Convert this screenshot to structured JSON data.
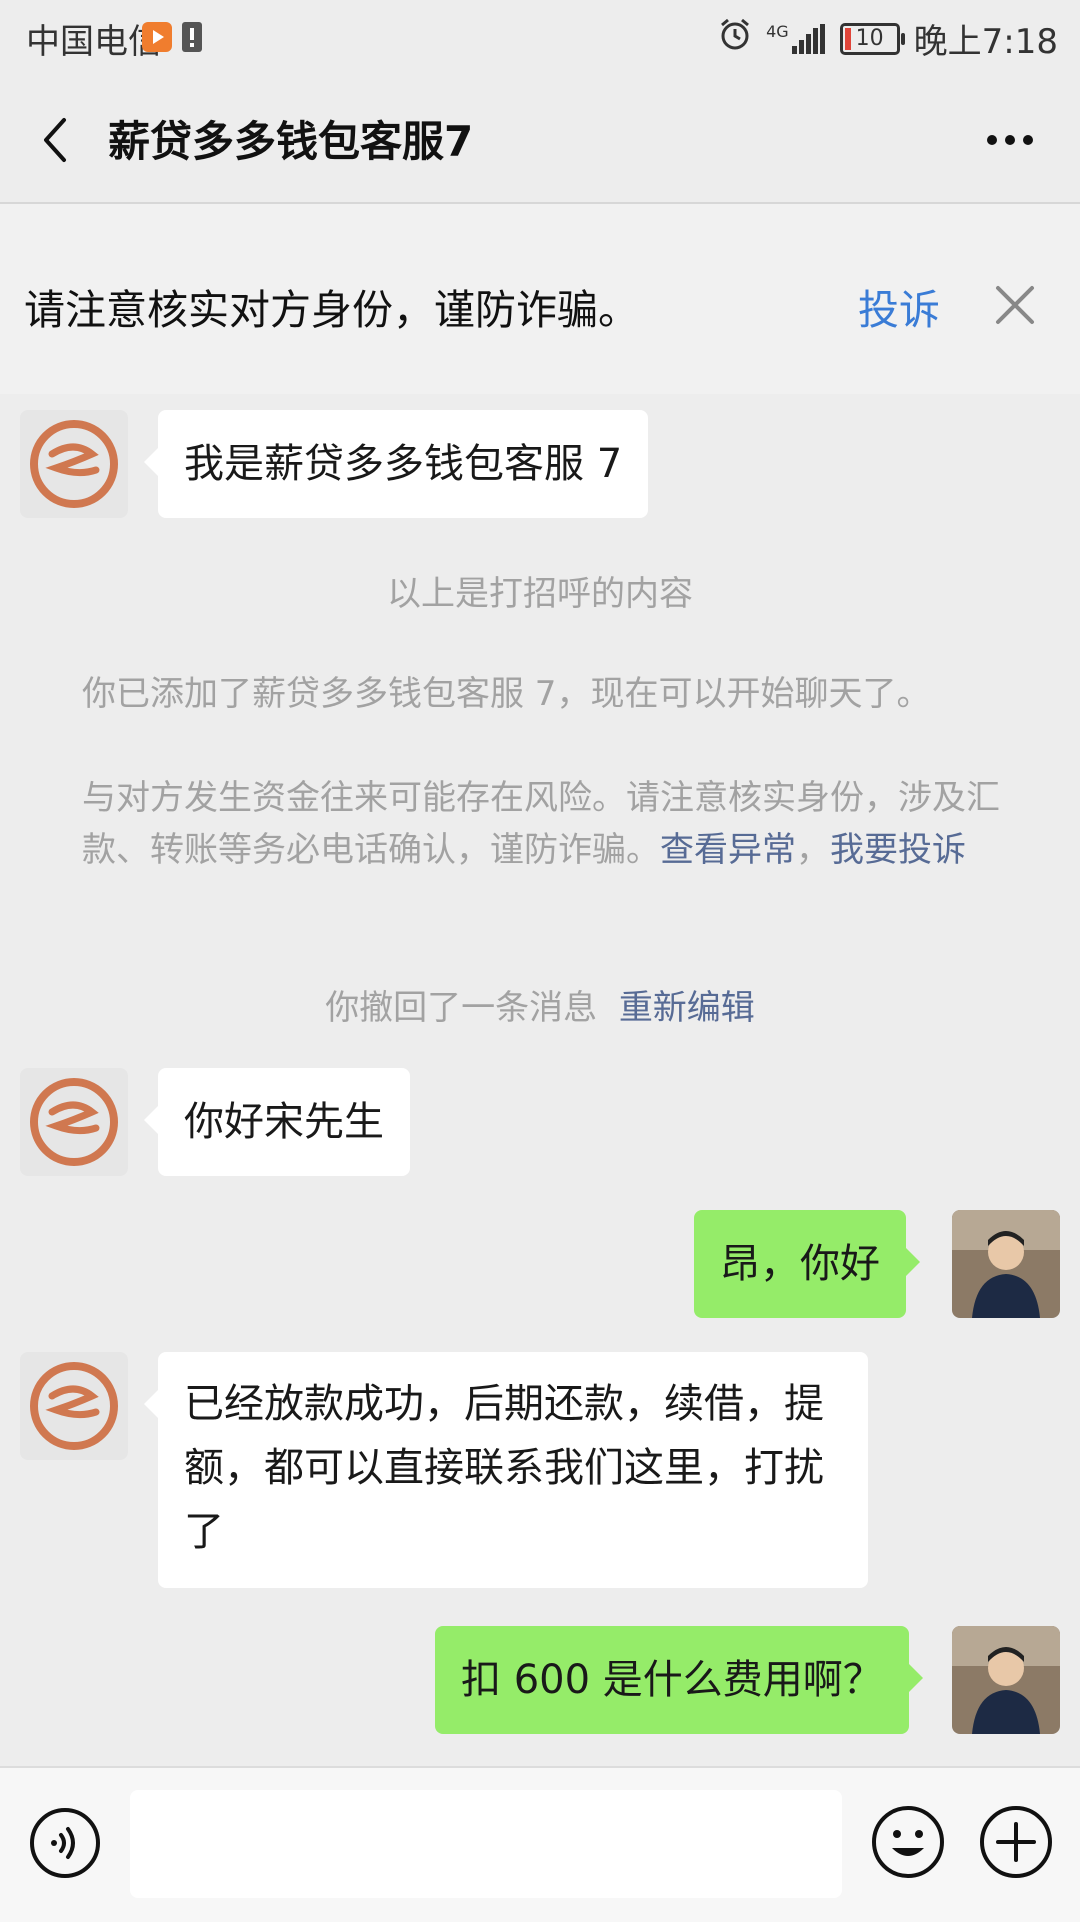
{
  "status_bar": {
    "carrier": "中国电信",
    "network": "4G",
    "battery": "10",
    "time": "晚上7:18"
  },
  "header": {
    "title": "薪贷多多钱包客服7",
    "back_icon": "chevron-left-icon",
    "more_icon": "more-dots-icon"
  },
  "warning": {
    "text": "请注意核实对方身份，谨防诈骗。",
    "complain_label": "投诉",
    "close_icon": "close-icon"
  },
  "messages": [
    {
      "side": "in",
      "text": "我是薪贷多多钱包客服 7"
    },
    {
      "side": "in",
      "text": "你好宋先生"
    },
    {
      "side": "out",
      "text": "昂，你好"
    },
    {
      "side": "in",
      "text": "已经放款成功，后期还款，续借，提额，都可以直接联系我们这里，打扰了"
    },
    {
      "side": "out",
      "text": "扣 600 是什么费用啊？"
    }
  ],
  "system": {
    "greeting_note": "以上是打招呼的内容",
    "added_note": "你已添加了薪贷多多钱包客服 7，现在可以开始聊天了。",
    "risk_note": "与对方发生资金往来可能存在风险。请注意核实身份，涉及汇款、转账等务必电话确认，谨防诈骗。",
    "risk_link_1": "查看异常",
    "risk_link_sep": "，",
    "risk_link_2": "我要投诉",
    "recall_note": "你撤回了一条消息",
    "recall_link": "重新编辑"
  },
  "input_bar": {
    "voice_icon": "voice-icon",
    "text_value": "",
    "emoji_icon": "emoji-icon",
    "plus_icon": "plus-icon"
  },
  "colors": {
    "background": "#ededed",
    "out_bubble": "#95ec69",
    "link": "#576b95",
    "complain": "#3a7cd6"
  }
}
